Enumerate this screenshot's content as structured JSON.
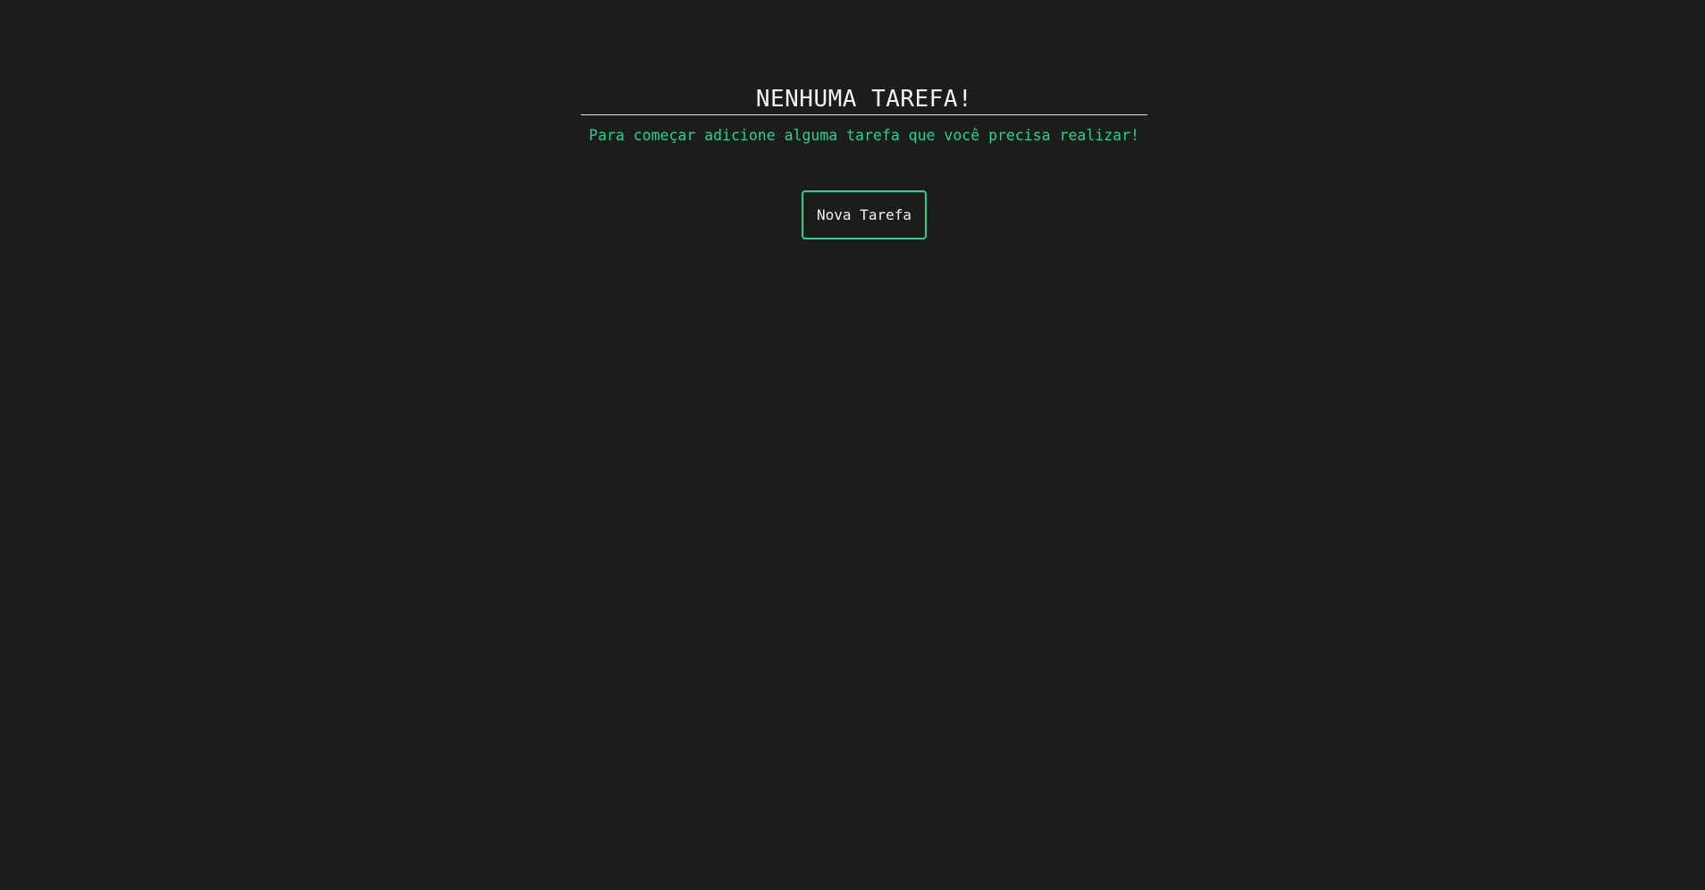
{
  "empty_state": {
    "title": "NENHUMA TAREFA!",
    "subtitle": "Para começar adicione alguma tarefa que você precisa realizar!",
    "button_label": "Nova Tarefa"
  },
  "colors": {
    "background": "#1c1c1c",
    "text": "#f2f2f2",
    "accent": "#1fd490",
    "divider": "#e6e6e6"
  }
}
